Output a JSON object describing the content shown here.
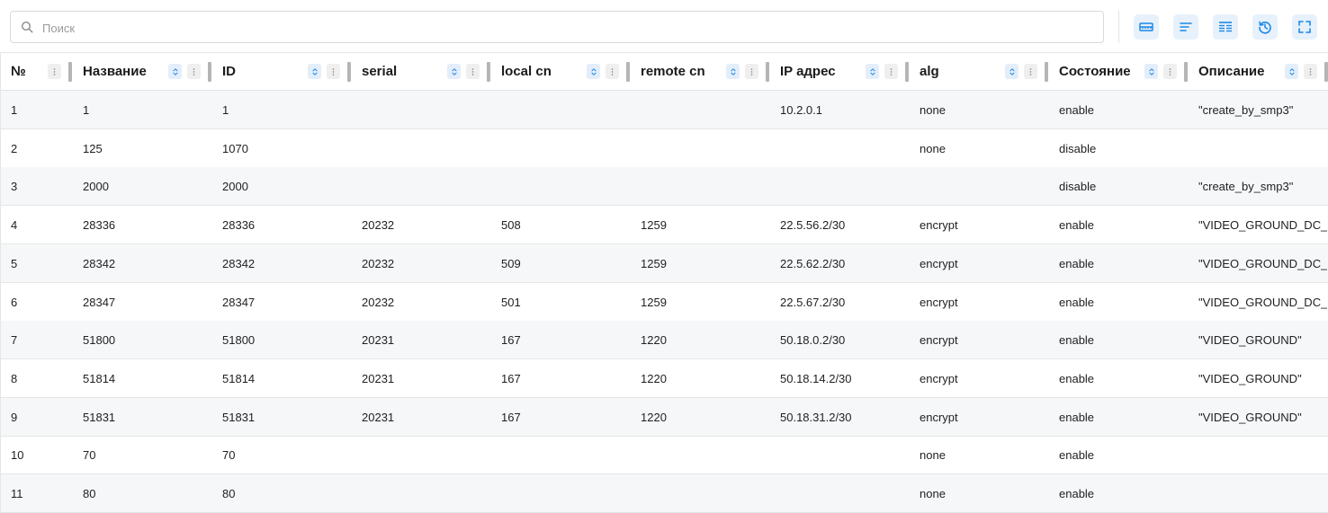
{
  "search": {
    "placeholder": "Поиск"
  },
  "toolbar_icons": [
    "ruler-icon",
    "align-left-icon",
    "columns-icon",
    "history-icon",
    "fullscreen-icon"
  ],
  "columns": [
    "№",
    "Название",
    "ID",
    "serial",
    "local cn",
    "remote cn",
    "IP адрес",
    "alg",
    "Состояние",
    "Описание"
  ],
  "rows": [
    [
      "1",
      "1",
      "1",
      "",
      "",
      "",
      "10.2.0.1",
      "none",
      "enable",
      "\"create_by_smp3\""
    ],
    [
      "2",
      "125",
      "1070",
      "",
      "",
      "",
      "",
      "none",
      "disable",
      ""
    ],
    [
      "3",
      "2000",
      "2000",
      "",
      "",
      "",
      "",
      "",
      "disable",
      "\"create_by_smp3\""
    ],
    [
      "4",
      "28336",
      "28336",
      "20232",
      "508",
      "1259",
      "22.5.56.2/30",
      "encrypt",
      "enable",
      "\"VIDEO_GROUND_DC_"
    ],
    [
      "5",
      "28342",
      "28342",
      "20232",
      "509",
      "1259",
      "22.5.62.2/30",
      "encrypt",
      "enable",
      "\"VIDEO_GROUND_DC_"
    ],
    [
      "6",
      "28347",
      "28347",
      "20232",
      "501",
      "1259",
      "22.5.67.2/30",
      "encrypt",
      "enable",
      "\"VIDEO_GROUND_DC_"
    ],
    [
      "7",
      "51800",
      "51800",
      "20231",
      "167",
      "1220",
      "50.18.0.2/30",
      "encrypt",
      "enable",
      "\"VIDEO_GROUND\""
    ],
    [
      "8",
      "51814",
      "51814",
      "20231",
      "167",
      "1220",
      "50.18.14.2/30",
      "encrypt",
      "enable",
      "\"VIDEO_GROUND\""
    ],
    [
      "9",
      "51831",
      "51831",
      "20231",
      "167",
      "1220",
      "50.18.31.2/30",
      "encrypt",
      "enable",
      "\"VIDEO_GROUND\""
    ],
    [
      "10",
      "70",
      "70",
      "",
      "",
      "",
      "",
      "none",
      "enable",
      ""
    ],
    [
      "11",
      "80",
      "80",
      "",
      "",
      "",
      "",
      "none",
      "enable",
      ""
    ]
  ],
  "colors": {
    "accent": "#1e88e5",
    "button_bg": "#e6f1fb",
    "row_alt": "#f6f7f9"
  }
}
